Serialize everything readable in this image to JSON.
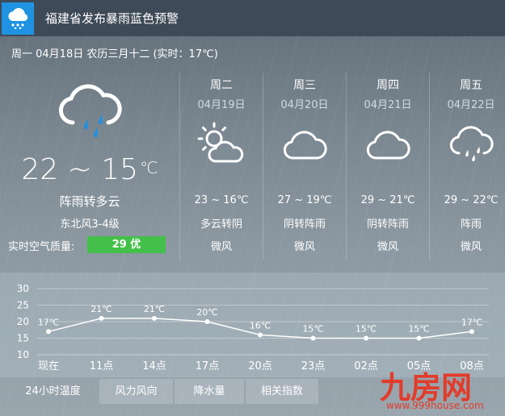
{
  "alert": {
    "title": "福建省发布暴雨蓝色预警",
    "icon": "rain-cloud-icon",
    "icon_bg": "#1f93e2"
  },
  "header": {
    "date_line": "周一 04月18日 农历三月十二 (实时：17℃)"
  },
  "today": {
    "icon": "cloud-rain-icon",
    "temp": "22 ~ 15",
    "temp_unit": "℃",
    "desc": "阵雨转多云",
    "wind": "东北风3-4级",
    "aqi_label": "实时空气质量:",
    "aqi_value": "29 优",
    "aqi_color": "#44c04a"
  },
  "forecast": [
    {
      "day": "周二",
      "date": "04月19日",
      "icon": "partly-sunny-icon",
      "temp": "23 ~ 16℃",
      "desc": "多云转阴",
      "wind": "微风"
    },
    {
      "day": "周三",
      "date": "04月20日",
      "icon": "cloud-icon",
      "temp": "27 ~ 19℃",
      "desc": "阴转阵雨",
      "wind": "微风"
    },
    {
      "day": "周四",
      "date": "04月21日",
      "icon": "cloud-icon",
      "temp": "29 ~ 21℃",
      "desc": "阴转阵雨",
      "wind": "微风"
    },
    {
      "day": "周五",
      "date": "04月22日",
      "icon": "cloud-rain-icon",
      "temp": "29 ~ 22℃",
      "desc": "阵雨",
      "wind": "微风"
    }
  ],
  "chart_data": {
    "type": "line",
    "title": "",
    "xlabel": "",
    "ylabel": "",
    "categories": [
      "现在",
      "11点",
      "14点",
      "17点",
      "20点",
      "23点",
      "02点",
      "05点",
      "08点"
    ],
    "series": [
      {
        "values": [
          17,
          21,
          21,
          20,
          16,
          15,
          15,
          15,
          17
        ]
      }
    ],
    "point_labels": [
      "17℃",
      "21℃",
      "21℃",
      "20℃",
      "16℃",
      "15℃",
      "15℃",
      "15℃",
      "17℃"
    ],
    "yticks": [
      10,
      15,
      20,
      25,
      30
    ],
    "ylim": [
      10,
      30
    ],
    "grid": true,
    "line_color": "#ffffff"
  },
  "tabs": [
    {
      "label": "24小时温度",
      "active": true
    },
    {
      "label": "风力风向",
      "active": false
    },
    {
      "label": "降水量",
      "active": false
    },
    {
      "label": "相关指数",
      "active": false
    }
  ],
  "watermark": {
    "logo": "九房网",
    "url": "www.999house.com",
    "color": "#e23b2b"
  }
}
